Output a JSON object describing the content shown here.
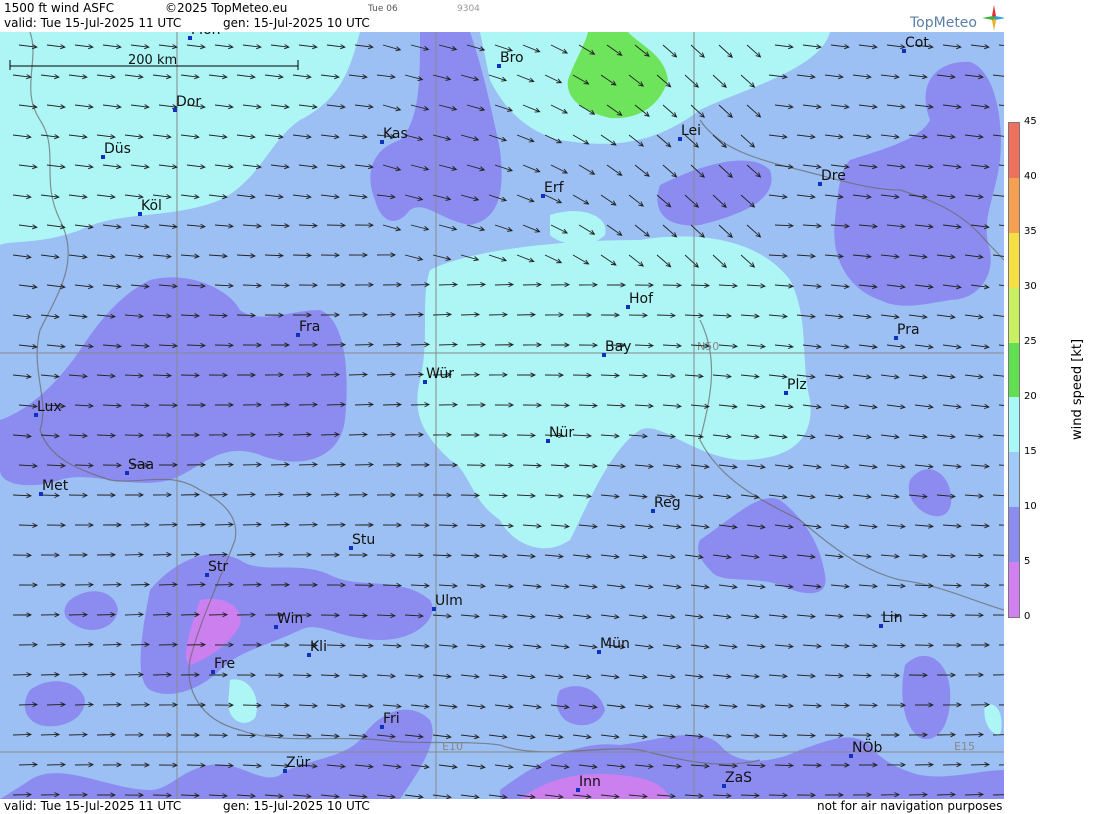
{
  "header": {
    "title": "1500 ft wind ASFC",
    "copyright": "©2025 TopMeteo.eu",
    "day": "Tue 06",
    "code": "9304",
    "valid": "valid:  Tue  15-Jul-2025  11 UTC",
    "gen": "gen: 15-Jul-2025 10 UTC",
    "logo": "TopMeteo"
  },
  "scale": {
    "label": "200 km"
  },
  "grid_labels": {
    "lat": "N50",
    "lon1": "E10",
    "lon2": "E15"
  },
  "cities": [
    {
      "name": "Mün",
      "label": "Mon"
    },
    {
      "name": "Bro",
      "label": "Bro"
    },
    {
      "name": "Cot",
      "label": "Cot"
    },
    {
      "name": "Dor",
      "label": "Dor"
    },
    {
      "name": "Kas",
      "label": "Kas"
    },
    {
      "name": "Lei",
      "label": "Lei"
    },
    {
      "name": "Düs",
      "label": "Düs"
    },
    {
      "name": "Erf",
      "label": "Erf"
    },
    {
      "name": "Dre",
      "label": "Dre"
    },
    {
      "name": "Köl",
      "label": "Köl"
    },
    {
      "name": "Hof",
      "label": "Hof"
    },
    {
      "name": "Fra",
      "label": "Fra"
    },
    {
      "name": "Pra",
      "label": "Pra"
    },
    {
      "name": "Bay",
      "label": "Bay"
    },
    {
      "name": "Wür",
      "label": "Wür"
    },
    {
      "name": "Plz",
      "label": "Plz"
    },
    {
      "name": "Lux",
      "label": "Lux"
    },
    {
      "name": "Nür",
      "label": "Nür"
    },
    {
      "name": "Saa",
      "label": "Saa"
    },
    {
      "name": "Met",
      "label": "Met"
    },
    {
      "name": "Reg",
      "label": "Reg"
    },
    {
      "name": "Stu",
      "label": "Stu"
    },
    {
      "name": "Str",
      "label": "Str"
    },
    {
      "name": "Ulm",
      "label": "Ulm"
    },
    {
      "name": "Win",
      "label": "Win"
    },
    {
      "name": "Lin",
      "label": "Lin"
    },
    {
      "name": "Kli",
      "label": "Kli"
    },
    {
      "name": "Mün2",
      "label": "Mün"
    },
    {
      "name": "Fre",
      "label": "Fre"
    },
    {
      "name": "Fri",
      "label": "Fri"
    },
    {
      "name": "NÖb",
      "label": "NÖb"
    },
    {
      "name": "Zür",
      "label": "Zür"
    },
    {
      "name": "ZaS",
      "label": "ZaS"
    },
    {
      "name": "Inn",
      "label": "Inn"
    }
  ],
  "colorbar": {
    "title": "wind speed [kt]",
    "ticks": [
      "45",
      "40",
      "35",
      "30",
      "25",
      "20",
      "15",
      "10",
      "5",
      "0"
    ],
    "colors": [
      "#f07060",
      "#f4a050",
      "#f4e040",
      "#c8f060",
      "#60e050",
      "#a8f8f8",
      "#a0c8f8",
      "#8c8cf0",
      "#b070f0",
      "#d080f0"
    ]
  },
  "footer": {
    "valid": "valid:  Tue  15-Jul-2025  11 UTC",
    "gen": "gen: 15-Jul-2025 10 UTC",
    "note": "not for air navigation purposes"
  }
}
